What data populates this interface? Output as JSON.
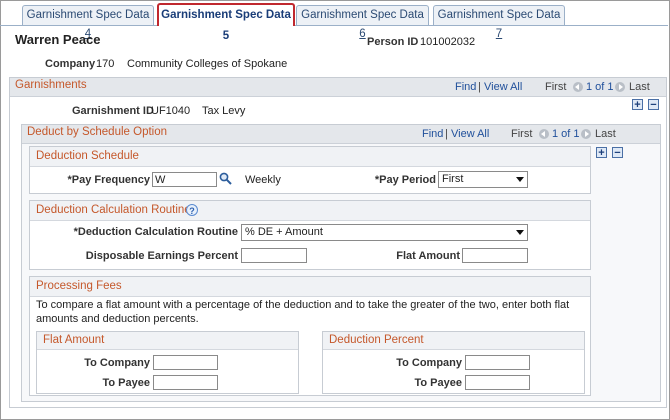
{
  "tabs": [
    {
      "text": "Garnishment Spec Data ",
      "key": "4"
    },
    {
      "text": "Garnishment Spec Data 5",
      "key": ""
    },
    {
      "text": "Garnishment Spec Data ",
      "key": "6"
    },
    {
      "text": "Garnishment Spec Data ",
      "key": "7"
    }
  ],
  "header": {
    "employee_name": "Warren Peace",
    "person_id_label": "Person ID",
    "person_id": "101002032",
    "company_label": "Company",
    "company_code": "170",
    "company_name": "Community Colleges of Spokane"
  },
  "garnishments": {
    "title": "Garnishments",
    "find": "Find",
    "sep": "|",
    "view_all": "View All",
    "first": "First",
    "count": "1 of 1",
    "last": "Last",
    "id_label": "Garnishment ID",
    "id_value": "UF1040",
    "id_desc": "Tax Levy"
  },
  "deduct": {
    "title": "Deduct by Schedule Option",
    "find": "Find",
    "sep": "|",
    "view_all": "View All",
    "first": "First",
    "count": "1 of 1",
    "last": "Last"
  },
  "schedule": {
    "title": "Deduction Schedule",
    "pay_freq_label": "*Pay Frequency",
    "pay_freq_value": "W",
    "pay_freq_desc": "Weekly",
    "pay_period_label": "*Pay Period",
    "pay_period_value": "First"
  },
  "calc": {
    "title": "Deduction Calculation Routine",
    "routine_label": "*Deduction Calculation Routine",
    "routine_value": "% DE + Amount",
    "disp_label": "Disposable Earnings Percent",
    "disp_value": "",
    "flat_label": "Flat Amount",
    "flat_value": ""
  },
  "fees": {
    "title": "Processing Fees",
    "note": "To compare a flat amount with a percentage of the deduction and to take the greater of the two, enter both flat amounts and deduction percents.",
    "flat_title": "Flat Amount",
    "pct_title": "Deduction Percent",
    "to_company": "To Company",
    "to_payee": "To Payee"
  },
  "icons": {
    "plus": "+",
    "minus": "−",
    "help": "?"
  }
}
